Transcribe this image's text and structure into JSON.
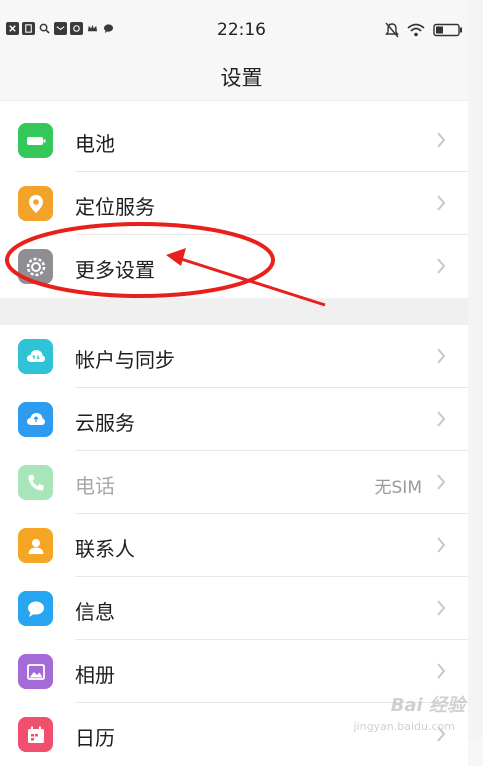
{
  "status_bar": {
    "time": "22:16",
    "left_icons": [
      "close-notification-icon",
      "sim-icon",
      "search-icon",
      "mail-icon",
      "weibo-icon",
      "crown-icon",
      "chat-icon"
    ],
    "right_icons": [
      "mute-icon",
      "wifi-icon",
      "battery-icon"
    ]
  },
  "page": {
    "title": "设置"
  },
  "groups": [
    {
      "items": [
        {
          "label": "电池",
          "icon": "battery-icon",
          "color": "#34c759",
          "value": ""
        },
        {
          "label": "定位服务",
          "icon": "location-pin-icon",
          "color": "#f4a32a",
          "value": ""
        },
        {
          "label": "更多设置",
          "icon": "gear-icon",
          "color": "#8e8e93",
          "value": ""
        }
      ]
    },
    {
      "items": [
        {
          "label": "帐户与同步",
          "icon": "cloud-sync-icon",
          "color": "#2fc3d8",
          "value": ""
        },
        {
          "label": "云服务",
          "icon": "cloud-icon",
          "color": "#2d9bf0",
          "value": ""
        },
        {
          "label": "电话",
          "icon": "phone-icon",
          "color": "#a8e6b9",
          "value": "无SIM",
          "disabled": true
        },
        {
          "label": "联系人",
          "icon": "contact-icon",
          "color": "#f5a623",
          "value": ""
        },
        {
          "label": "信息",
          "icon": "message-icon",
          "color": "#28a5f0",
          "value": ""
        },
        {
          "label": "相册",
          "icon": "photo-icon",
          "color": "#a46bd8",
          "value": ""
        },
        {
          "label": "日历",
          "icon": "calendar-icon",
          "color": "#f0506e",
          "value": ""
        }
      ]
    }
  ],
  "annotation": {
    "color": "#e8201c",
    "target": "更多设置"
  },
  "watermark": {
    "text": "Bai 经验",
    "sub": "jingyan.baidu.com"
  }
}
